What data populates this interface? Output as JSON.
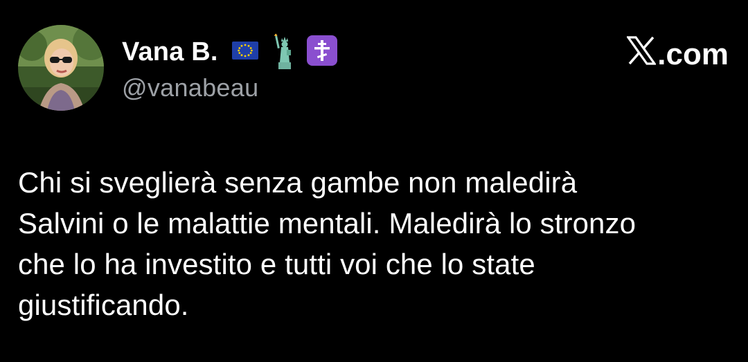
{
  "author": {
    "display_name": "Vana B.",
    "handle": "@vanabeau",
    "badges": [
      "eu-flag-icon",
      "statue-of-liberty-icon",
      "orthodox-cross-icon"
    ]
  },
  "brand": {
    "dotcom": ".com"
  },
  "tweet": {
    "text": "Chi si sveglierà senza gambe non maledirà\nSalvini o le malattie mentali. Maledirà lo stronzo\nche lo ha investito e tutti voi che lo state\ngiustificando."
  },
  "colors": {
    "background": "#000000",
    "text": "#ffffff",
    "handle": "#9da1a6",
    "badge_purple": "#8a4fcf",
    "eu_blue": "#1f3fa8",
    "eu_star": "#ffd200"
  }
}
